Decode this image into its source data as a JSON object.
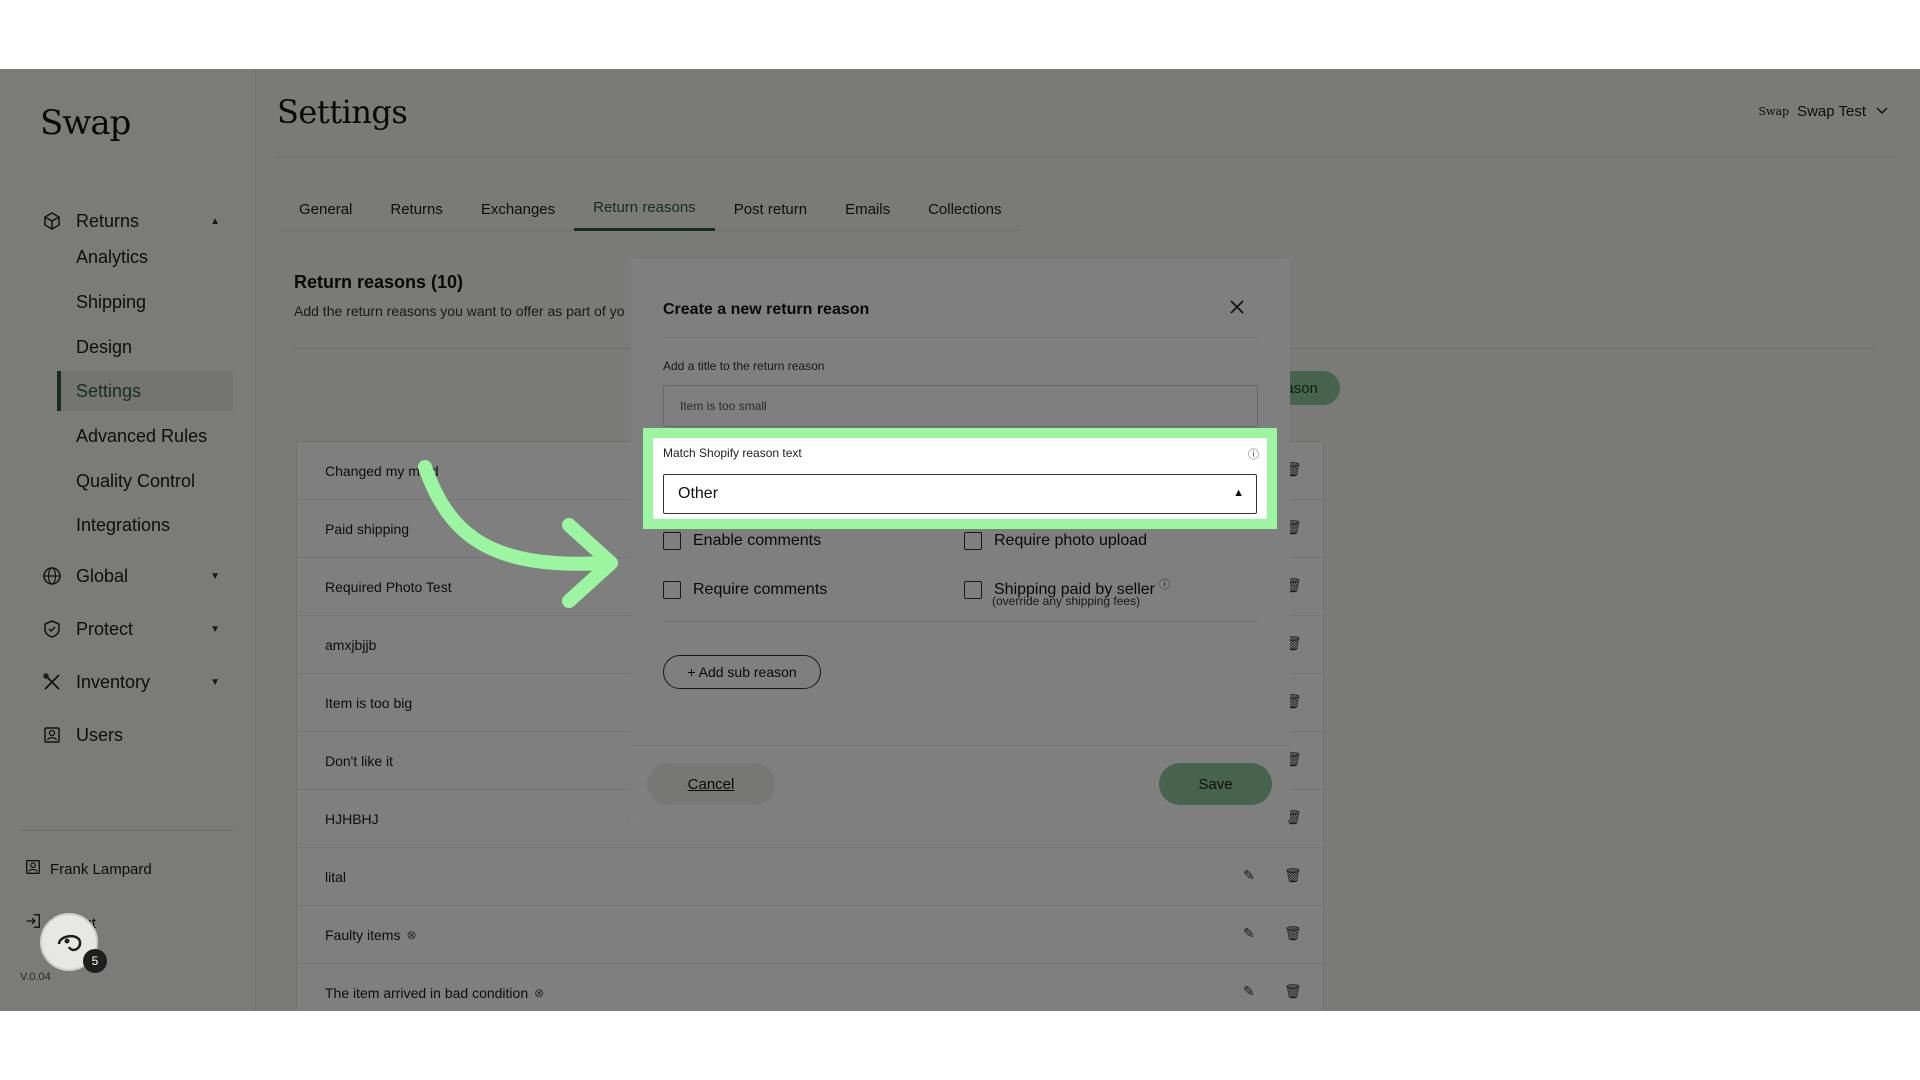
{
  "app": {
    "logo": "Swap",
    "version": "V.0.04"
  },
  "sidebar": {
    "returns": {
      "label": "Returns"
    },
    "sub_items": [
      "Analytics",
      "Shipping",
      "Design",
      "Settings",
      "Advanced Rules",
      "Quality Control",
      "Integrations"
    ],
    "global": {
      "label": "Global"
    },
    "protect": {
      "label": "Protect"
    },
    "inventory": {
      "label": "Inventory"
    },
    "users": {
      "label": "Users"
    },
    "user_name": "Frank Lampard",
    "logout_label": "Logout",
    "chat_badge": "5"
  },
  "header": {
    "title": "Settings",
    "store_logo": "Swap",
    "store_name": "Swap Test"
  },
  "tabs": [
    "General",
    "Returns",
    "Exchanges",
    "Return reasons",
    "Post return",
    "Emails",
    "Collections"
  ],
  "section": {
    "title": "Return reasons (10)",
    "description": "Add the return reasons you want to offer as part of yo",
    "add_button": "ason"
  },
  "reasons": [
    "Changed my mind",
    "Paid shipping",
    "Required Photo Test",
    "amxjbjjb",
    "Item is too big",
    "Don't like it",
    "HJHBHJ",
    "lital",
    "Faulty items",
    "The item arrived in bad condition"
  ],
  "modal": {
    "title": "Create a new return reason",
    "title_field_label": "Add a title to the return reason",
    "title_field_value": "Item is too small",
    "match_label": "Match Shopify reason text",
    "match_value": "Other",
    "enable_comments": "Enable comments",
    "require_photo": "Require photo upload",
    "require_comments": "Require comments",
    "shipping_paid": "Shipping paid by seller",
    "shipping_note": "(override any shipping fees)",
    "add_sub_reason": "+ Add sub reason",
    "cancel": "Cancel",
    "save": "Save"
  },
  "colors": {
    "accent": "#2f5d3a",
    "button_green": "#8fc49a",
    "highlight": "#9cf5a0"
  }
}
